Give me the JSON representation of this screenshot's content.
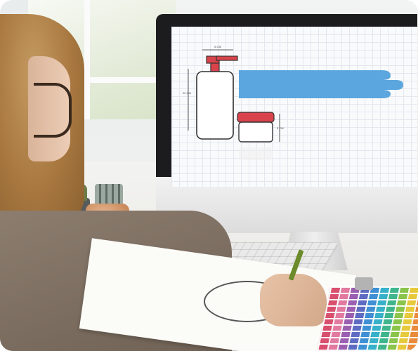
{
  "scene": {
    "description_colors": {
      "banner_blue": "#5ba6de",
      "cap_red": "#d9434b",
      "outline": "#333333",
      "grid_line": "#e3e7ee"
    },
    "screen": {
      "dimension_labels": {
        "bottle_width": "6 CM",
        "bottle_height": "20 CM",
        "jar_height": "5 CM"
      }
    }
  }
}
